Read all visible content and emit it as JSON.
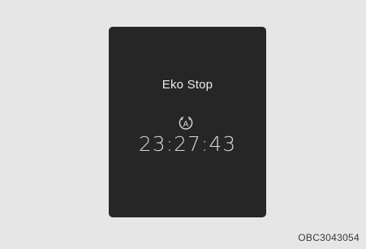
{
  "screen": {
    "title": "Eko Stop",
    "icon": "auto-stop-icon",
    "icon_letter": "A",
    "time": "23:27:43"
  },
  "figure_code": "OBC3043054",
  "colors": {
    "background": "#e6e6e6",
    "screen": "#262626",
    "screen_text": "#ececec"
  }
}
